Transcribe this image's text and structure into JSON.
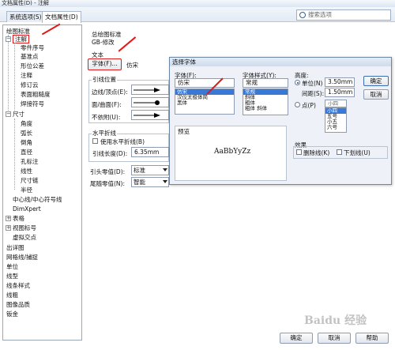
{
  "window": {
    "title": "文档属性(D) - 注解"
  },
  "tabs": [
    {
      "label": "系统选项(S)"
    },
    {
      "label": "文档属性(D)"
    }
  ],
  "search": {
    "placeholder": "搜索选项"
  },
  "tree": {
    "items": [
      {
        "label": "绘图标准"
      },
      {
        "label": "注解"
      },
      {
        "label": "零件序号"
      },
      {
        "label": "基准点"
      },
      {
        "label": "形位公差"
      },
      {
        "label": "注释"
      },
      {
        "label": "修订云"
      },
      {
        "label": "表面粗糙度"
      },
      {
        "label": "焊接符号"
      },
      {
        "label": "尺寸"
      },
      {
        "label": "角度"
      },
      {
        "label": "弧长"
      },
      {
        "label": "倒角"
      },
      {
        "label": "直径"
      },
      {
        "label": "孔标注"
      },
      {
        "label": "线性"
      },
      {
        "label": "尺寸链"
      },
      {
        "label": "半径"
      },
      {
        "label": "中心线/中心符号线"
      },
      {
        "label": "DimXpert"
      },
      {
        "label": "表格"
      },
      {
        "label": "视图标号"
      },
      {
        "label": "虚拟交点"
      },
      {
        "label": "出详图"
      },
      {
        "label": "网格线/捕捉"
      },
      {
        "label": "单位"
      },
      {
        "label": "线型"
      },
      {
        "label": "线条样式"
      },
      {
        "label": "线粗"
      },
      {
        "label": "图像品质"
      },
      {
        "label": "钣金"
      }
    ]
  },
  "main": {
    "standard_group": "总绘图标准",
    "standard_value": "GB-修改",
    "text_group": "文本",
    "font_button": "字体(F)...",
    "font_value": "仿宋",
    "leader_group": "引线位置",
    "leader_rows": [
      {
        "label": "边线/顶点(E):"
      },
      {
        "label": "面/曲面(F):"
      },
      {
        "label": "不依附(U):"
      }
    ],
    "horizontal_group": "水平折线",
    "use_horizontal": "使用水平折线(B)",
    "leader_length_label": "引线长度(D):",
    "leader_length_value": "6.35mm",
    "leader_zero_label": "引头零值(D):",
    "leader_zero_value": "标准",
    "trailing_zero_label": "尾随零值(N):",
    "trailing_zero_value": "智能"
  },
  "font_dialog": {
    "title": "选择字体",
    "font_label": "字体(F):",
    "font_input": "仿宋",
    "font_list": [
      "仿宋",
      "汉仪太极体简",
      "黑体"
    ],
    "style_label": "字体样式(Y):",
    "style_input": "常规",
    "style_list": [
      "常规",
      "斜体",
      "粗体",
      "粗体 斜体"
    ],
    "height_group": "高度:",
    "unit_label": "单位(N)",
    "unit_value": "3.50mm",
    "spacing_label": "间距(S):",
    "spacing_value": "1.50mm",
    "point_label": "点(P)",
    "point_input": "小四",
    "size_list": [
      "小四",
      "五号",
      "小五",
      "六号"
    ],
    "ok": "确定",
    "cancel": "取消",
    "preview_group": "预览",
    "preview_text": "AaBbYyZz",
    "effects_group": "效果",
    "strikeout": "删除线(K)",
    "underline": "下划线(U)"
  },
  "footer": {
    "ok": "确定",
    "cancel": "取消",
    "help": "帮助"
  },
  "watermark": "Baidu 经验",
  "colors": {
    "selection": "#3878d6",
    "annotation_red": "#e01a1a",
    "titlebar": "#dbe6f3"
  }
}
